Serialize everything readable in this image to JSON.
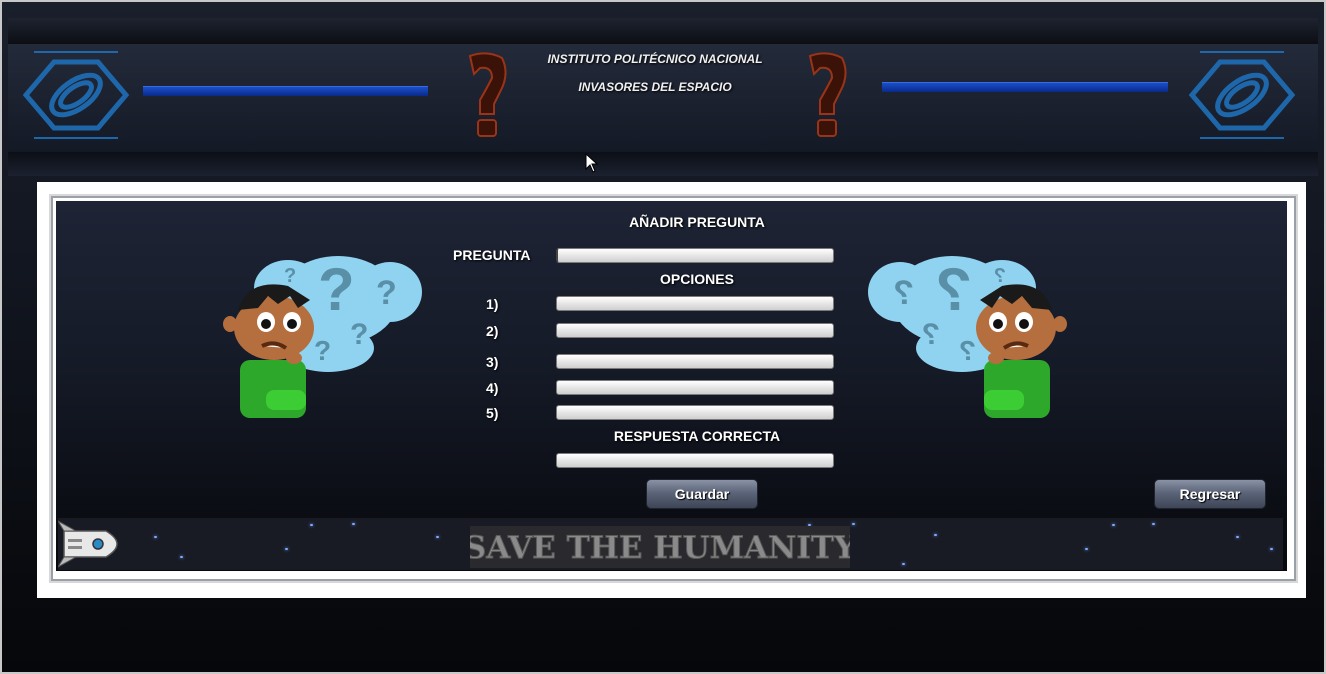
{
  "header": {
    "institute": "INSTITUTO POLITÉCNICO NACIONAL",
    "game_title": "INVASORES DEL ESPACIO"
  },
  "form": {
    "title": "AÑADIR PREGUNTA",
    "question_label": "PREGUNTA",
    "question_value": "",
    "options_label": "OPCIONES",
    "options": [
      {
        "label": "1)",
        "value": ""
      },
      {
        "label": "2)",
        "value": ""
      },
      {
        "label": "3)",
        "value": ""
      },
      {
        "label": "4)",
        "value": ""
      },
      {
        "label": "5)",
        "value": ""
      }
    ],
    "correct_label": "RESPUESTA CORRECTA",
    "correct_value": "",
    "save_button": "Guardar",
    "back_button": "Regresar"
  },
  "footer": {
    "banner_text": "SAVE THE HUMANITY"
  },
  "colors": {
    "accent_blue": "#1a4fc8",
    "logo_blue": "#1e6fb8",
    "qmark_red": "#8a2a14"
  }
}
